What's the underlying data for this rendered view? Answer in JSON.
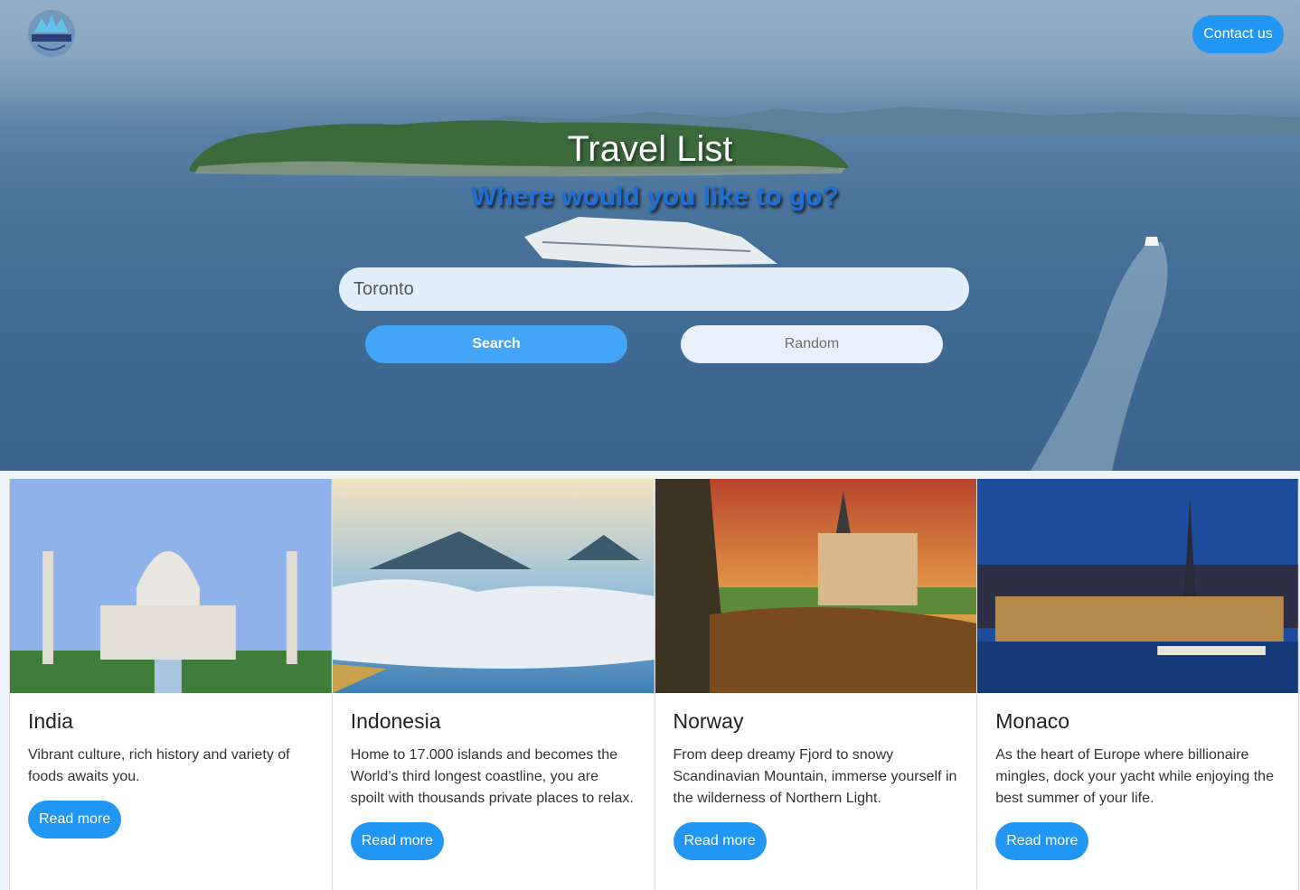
{
  "header": {
    "contact_label": "Contact us"
  },
  "hero": {
    "title": "Travel List",
    "subtitle": "Where would you like to go?",
    "search_value": "Toronto",
    "search_label": "Search",
    "random_label": "Random"
  },
  "colors": {
    "accent": "#2196f3",
    "search_button": "#42a5f5",
    "subtitle": "#1e6fd6"
  },
  "cards": [
    {
      "title": "India",
      "text": "Vibrant culture, rich history and variety of foods awaits you.",
      "button": "Read more"
    },
    {
      "title": "Indonesia",
      "text": "Home to 17.000 islands and becomes the World’s third longest coastline, you are spoilt with thousands private places to relax.",
      "button": "Read more"
    },
    {
      "title": "Norway",
      "text": "From deep dreamy Fjord to snowy Scandinavian Mountain, immerse yourself in the wilderness of Northern Light.",
      "button": "Read more"
    },
    {
      "title": "Monaco",
      "text": "As the heart of Europe where billionaire mingles, dock your yacht while enjoying the best summer of your life.",
      "button": "Read more"
    }
  ]
}
